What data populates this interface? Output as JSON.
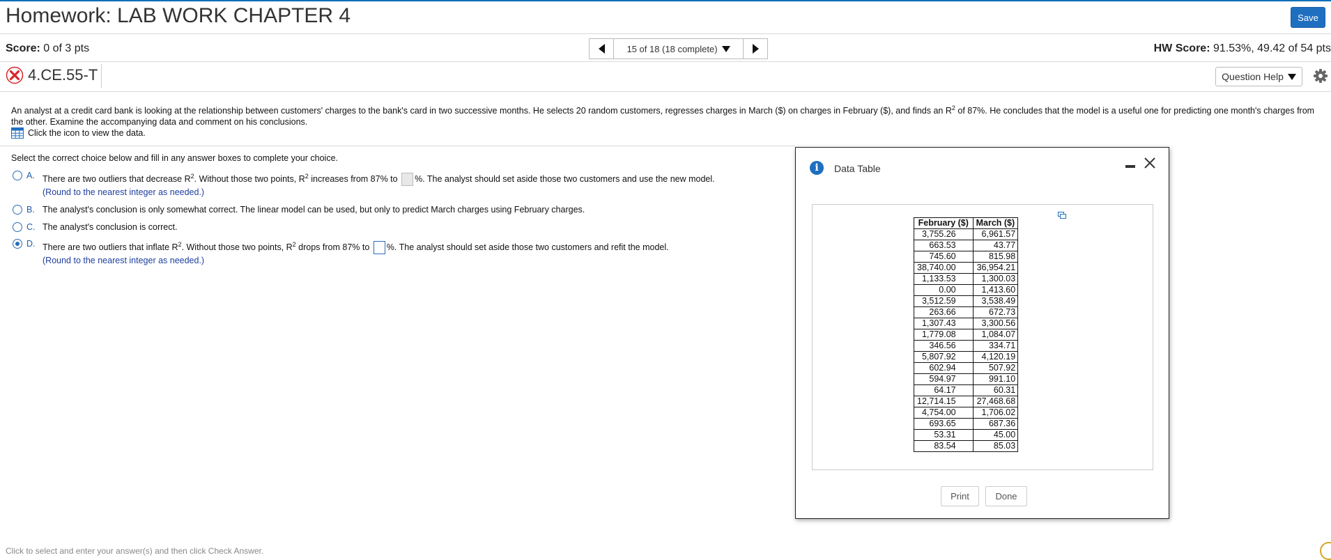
{
  "header": {
    "title": "Homework: LAB WORK CHAPTER 4",
    "save_label": "Save",
    "score_label": "Score:",
    "score_value": "0 of 3 pts",
    "nav_label": "15 of 18 (18 complete)",
    "hw_score_label": "HW Score:",
    "hw_score_value": "91.53%, 49.42 of 54 pts"
  },
  "question": {
    "id": "4.CE.55-T",
    "help_label": "Question Help",
    "problem_text_before": "An analyst at a credit card bank is looking at the relationship between customers' charges to the bank's card in two successive months. He selects 20 random customers, regresses charges in March ($) on charges in February ($), and finds an R",
    "problem_text_after": " of 87%. He concludes that the model is a useful one for predicting one month's charges from the other. Examine the accompanying data and comment on his conclusions.",
    "view_data_label": "Click the icon to view the data.",
    "instruction": "Select the correct choice below and fill in any answer boxes to complete your choice."
  },
  "choices": {
    "a": {
      "letter": "A.",
      "part1": "There are two outliers that decrease R",
      "part2": ". Without those two points, R",
      "part3": " increases from 87% to ",
      "part4": "%. The analyst should set aside those two customers and use the new model.",
      "note": "(Round to the nearest integer as needed.)"
    },
    "b": {
      "letter": "B.",
      "text": "The analyst's conclusion is only somewhat correct. The linear model can be used, but only to predict March charges using February charges."
    },
    "c": {
      "letter": "C.",
      "text": "The analyst's conclusion is correct."
    },
    "d": {
      "letter": "D.",
      "part1": "There are two outliers that inflate R",
      "part2": ". Without those two points, R",
      "part3": " drops from 87% to ",
      "part4": "%. The analyst should set aside those two customers and refit the model.",
      "note": "(Round to the nearest integer as needed.)"
    },
    "selected": "d",
    "superscript": "2"
  },
  "footer": {
    "text": "Click to select and enter your answer(s) and then click Check Answer."
  },
  "dialog": {
    "title": "Data Table",
    "columns": [
      "February ($)",
      "March ($)"
    ],
    "rows": [
      [
        "3,755.26",
        "6,961.57"
      ],
      [
        "663.53",
        "43.77"
      ],
      [
        "745.60",
        "815.98"
      ],
      [
        "38,740.00",
        "36,954.21"
      ],
      [
        "1,133.53",
        "1,300.03"
      ],
      [
        "0.00",
        "1,413.60"
      ],
      [
        "3,512.59",
        "3,538.49"
      ],
      [
        "263.66",
        "672.73"
      ],
      [
        "1,307.43",
        "3,300.56"
      ],
      [
        "1,779.08",
        "1,084.07"
      ],
      [
        "346.56",
        "334.71"
      ],
      [
        "5,807.92",
        "4,120.19"
      ],
      [
        "602.94",
        "507.92"
      ],
      [
        "594.97",
        "991.10"
      ],
      [
        "64.17",
        "60.31"
      ],
      [
        "12,714.15",
        "27,468.68"
      ],
      [
        "4,754.00",
        "1,706.02"
      ],
      [
        "693.65",
        "687.36"
      ],
      [
        "53.31",
        "45.00"
      ],
      [
        "83.54",
        "85.03"
      ]
    ],
    "print_label": "Print",
    "done_label": "Done"
  },
  "colors": {
    "accent": "#1f6fc0",
    "incorrect": "#d9262b",
    "note": "#1e3f9e"
  }
}
